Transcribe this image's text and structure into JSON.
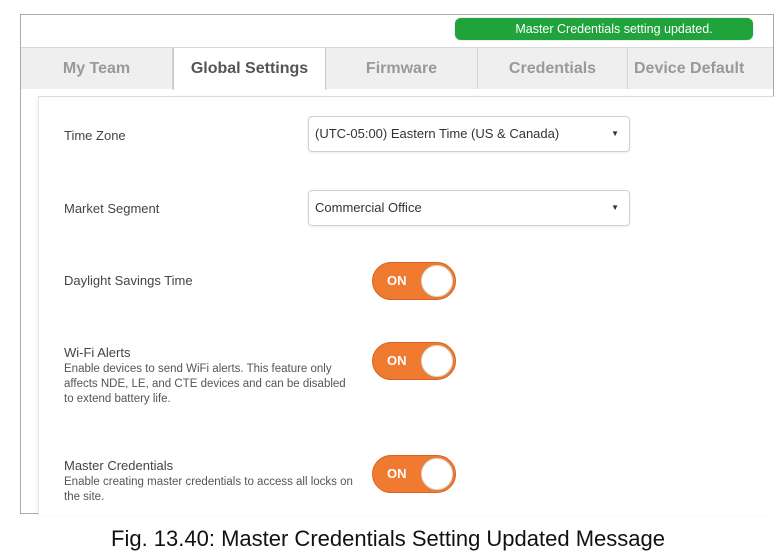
{
  "toast": {
    "message": "Master Credentials setting updated.",
    "color": "#1fa33a"
  },
  "tabs": [
    {
      "label": "My Team",
      "active": false
    },
    {
      "label": "Global Settings",
      "active": true
    },
    {
      "label": "Firmware",
      "active": false
    },
    {
      "label": "Credentials",
      "active": false
    },
    {
      "label": "Device Default",
      "active": false
    }
  ],
  "settings": {
    "time_zone": {
      "label": "Time Zone",
      "value": "(UTC-05:00) Eastern Time (US & Canada)"
    },
    "market_segment": {
      "label": "Market Segment",
      "value": "Commercial Office"
    },
    "daylight_savings": {
      "label": "Daylight Savings Time",
      "toggle": "ON"
    },
    "wifi_alerts": {
      "label": "Wi-Fi Alerts",
      "description": "Enable devices to send WiFi alerts. This feature only affects NDE, LE, and CTE devices and can be disabled to extend battery life.",
      "toggle": "ON"
    },
    "master_credentials": {
      "label": "Master Credentials",
      "description": "Enable creating master credentials to access all locks on the site.",
      "toggle": "ON"
    }
  },
  "toggle_color": "#f07a2f",
  "caption": "Fig. 13.40: Master Credentials Setting Updated Message"
}
